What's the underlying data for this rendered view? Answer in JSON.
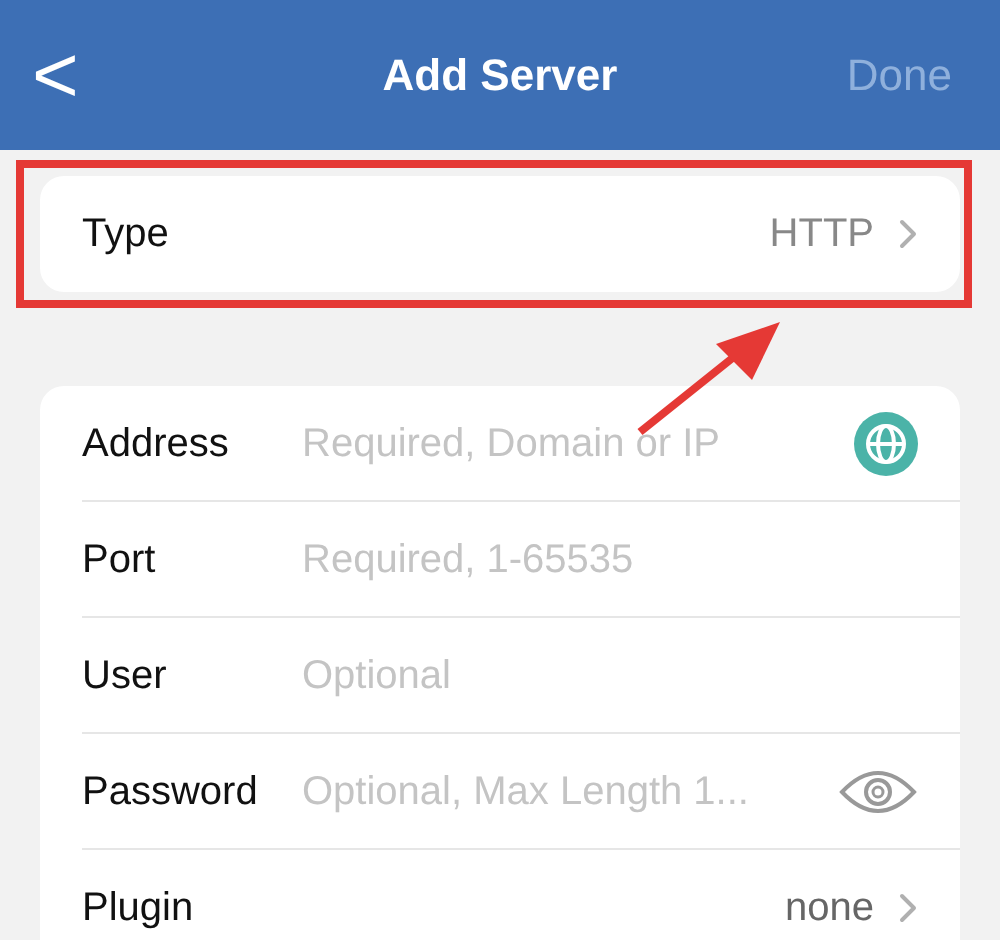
{
  "nav_bar": {
    "back": "<",
    "title": "Add Server",
    "done": {
      "label": "Done",
      "disabled": true
    }
  },
  "type_row": {
    "label": "Type",
    "value": "HTTP"
  },
  "rows": [
    {
      "kind": "globe",
      "label": "Address",
      "placeholder": "Required, Domain or IP"
    },
    {
      "kind": "text",
      "label": "Port",
      "placeholder": "Required, 1-65535"
    },
    {
      "kind": "text",
      "label": "User",
      "placeholder": "Optional"
    },
    {
      "kind": "secret",
      "label": "Password",
      "placeholder": "Optional, Max Length 1..."
    },
    {
      "kind": "select",
      "label": "Plugin",
      "value": "none"
    }
  ]
}
